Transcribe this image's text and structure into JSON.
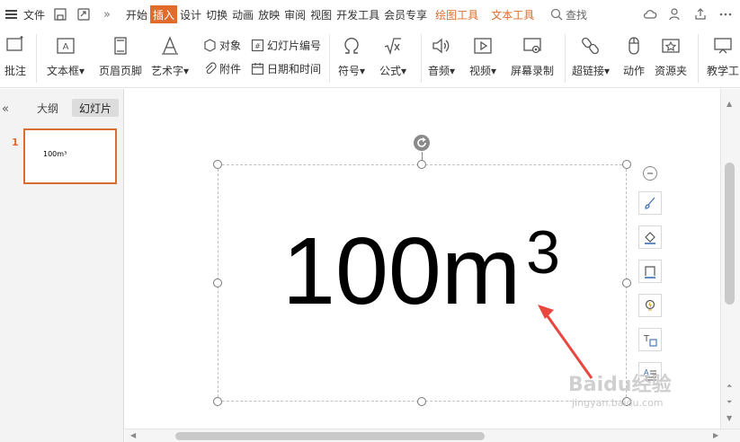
{
  "menubar": {
    "file_label": "文件",
    "tabs": [
      "开始",
      "插入",
      "设计",
      "切换",
      "动画",
      "放映",
      "审阅",
      "视图",
      "开发工具",
      "会员专享"
    ],
    "active_tab": "插入",
    "special_tabs": [
      "绘图工具",
      "文本工具"
    ],
    "search_label": "查找"
  },
  "ribbon": {
    "comment": "批注",
    "textbox": "文本框",
    "header_footer": "页眉页脚",
    "wordart": "艺术字",
    "object": "对象",
    "attachment": "附件",
    "slide_number": "幻灯片编号",
    "date_time": "日期和时间",
    "symbol": "符号",
    "formula": "公式",
    "audio": "音频",
    "video": "视频",
    "screen_record": "屏幕录制",
    "hyperlink": "超链接",
    "action": "动作",
    "resource": "资源夹",
    "teaching": "教学工"
  },
  "leftpanel": {
    "collapse_symbol": "«",
    "tab_outline": "大纲",
    "tab_slides": "幻灯片",
    "slide_number": "1",
    "thumb_text": "100m³"
  },
  "canvas": {
    "main_text": "100m",
    "superscript": "3"
  },
  "colors": {
    "accent": "#e06b2d",
    "arrow": "#e8473f"
  },
  "watermark": {
    "main": "Baidu经验",
    "sub": "jingyan.baidu.com"
  }
}
